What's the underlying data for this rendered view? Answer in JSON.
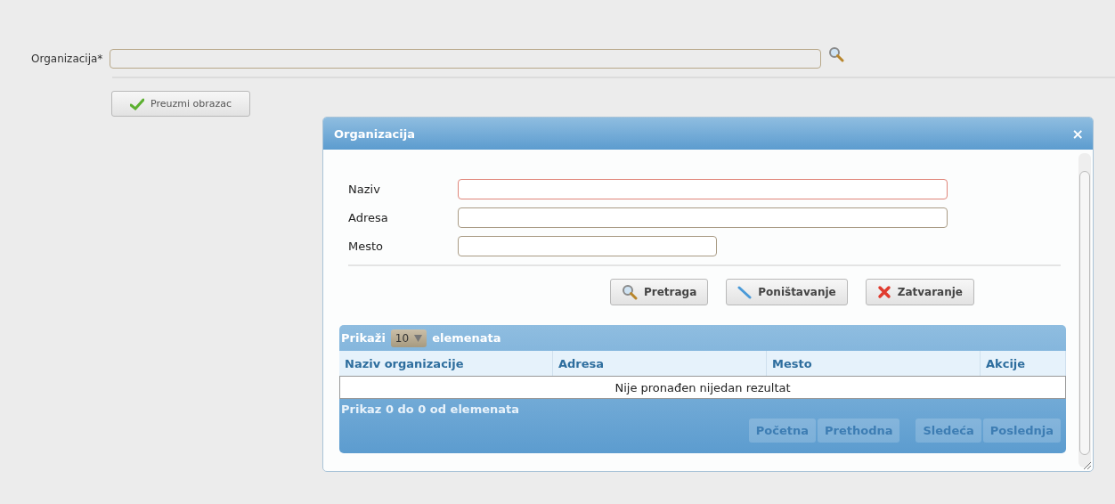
{
  "form": {
    "label": "Organizacija*",
    "submit_button": "Preuzmi obrazac"
  },
  "dialog": {
    "title": "Organizacija",
    "close": "×",
    "fields": [
      {
        "label": "Naziv",
        "focused": true,
        "kind": "wide"
      },
      {
        "label": "Adresa",
        "focused": false,
        "kind": "wide"
      },
      {
        "label": "Mesto",
        "focused": false,
        "kind": "narrow"
      }
    ],
    "buttons": [
      {
        "label": "Pretraga",
        "kind": "search"
      },
      {
        "label": "Poništavanje",
        "kind": "clear"
      },
      {
        "label": "Zatvaranje",
        "kind": "close"
      }
    ],
    "table": {
      "show_label": "Prikaži",
      "page_size": "10",
      "show_suffix": "elemenata",
      "columns": [
        "Naziv organizacije",
        "Adresa",
        "Mesto",
        "Akcije"
      ],
      "empty_message": "Nije pronađen nijedan rezultat",
      "info": "Prikaz 0 do 0 od elemenata",
      "pagination": [
        [
          {
            "label": "Početna",
            "disabled": true
          },
          {
            "label": "Prethodna",
            "disabled": true
          }
        ],
        [
          {
            "label": "Sledeća",
            "disabled": true
          },
          {
            "label": "Poslednja",
            "disabled": true
          }
        ]
      ]
    }
  }
}
